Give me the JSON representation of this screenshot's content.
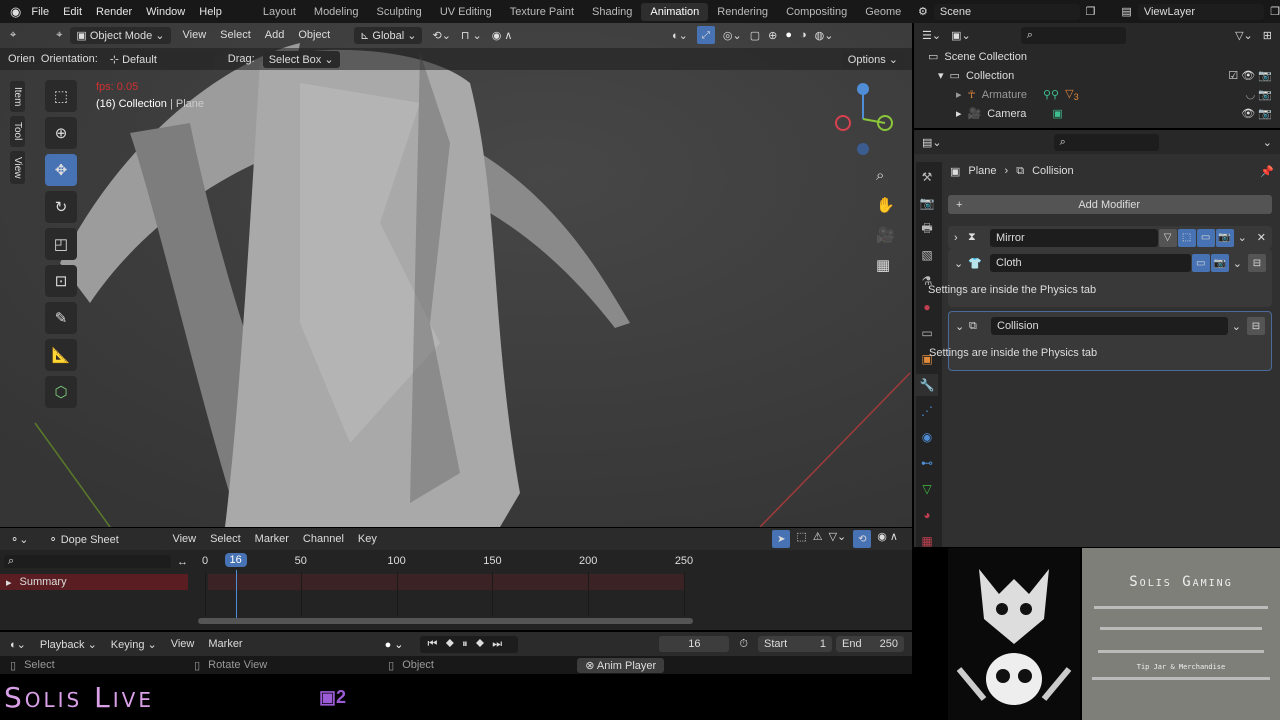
{
  "topbar": {
    "menus": [
      "File",
      "Edit",
      "Render",
      "Window",
      "Help"
    ],
    "workspaces": [
      "Layout",
      "Modeling",
      "Sculpting",
      "UV Editing",
      "Texture Paint",
      "Shading",
      "Animation",
      "Rendering",
      "Compositing",
      "Geome"
    ],
    "active_workspace": "Animation",
    "scene": "Scene",
    "view_layer": "ViewLayer"
  },
  "viewport": {
    "mode": "Object Mode",
    "menus": [
      "View",
      "Select",
      "Add",
      "Object"
    ],
    "transform": "Global",
    "orientation_label": "Orientation:",
    "orientation_value": "Default",
    "orient_cut": "Orien",
    "drag_label": "Drag:",
    "drag_value": "Select Box",
    "options": "Options",
    "fps": "fps: 0.05",
    "collection_info": "(16) Collection",
    "object_info": "| Plane",
    "side_tabs": [
      "Item",
      "Tool",
      "View"
    ],
    "tools": [
      "select-box",
      "cursor",
      "move",
      "rotate",
      "scale",
      "transform",
      "annotate",
      "measure",
      "add-cube"
    ]
  },
  "outliner": {
    "root": "Scene Collection",
    "collection": "Collection",
    "items": [
      {
        "name": "Armature",
        "badge": "3"
      },
      {
        "name": "Camera"
      }
    ]
  },
  "properties": {
    "breadcrumb_object": "Plane",
    "breadcrumb_modifier": "Collision",
    "add_modifier": "Add Modifier",
    "modifiers": [
      {
        "name": "Mirror",
        "expanded": false
      },
      {
        "name": "Cloth",
        "expanded": true,
        "note": "Settings are inside the Physics tab"
      },
      {
        "name": "Collision",
        "expanded": true,
        "note": "Settings are inside the Physics tab"
      }
    ]
  },
  "dopesheet": {
    "editor": "Dope Sheet",
    "menus": [
      "View",
      "Select",
      "Marker",
      "Channel",
      "Key"
    ],
    "channel": "Summary",
    "ticks": [
      "0",
      "50",
      "100",
      "150",
      "200",
      "250"
    ],
    "current_frame": "16"
  },
  "timeline": {
    "menus": [
      "Playback",
      "Keying",
      "View",
      "Marker"
    ],
    "frame": "16",
    "start_label": "Start",
    "start": "1",
    "end_label": "End",
    "end": "250"
  },
  "status": {
    "select": "Select",
    "rotate": "Rotate View",
    "object": "Object",
    "anim_player": "Anim Player"
  },
  "overlay": {
    "brand": "Solis Live",
    "viewers": "2",
    "panel_title": "Solis Gaming",
    "panel_subtitle": "Tip Jar & Merchandise",
    "accent": "#c77ddb"
  }
}
